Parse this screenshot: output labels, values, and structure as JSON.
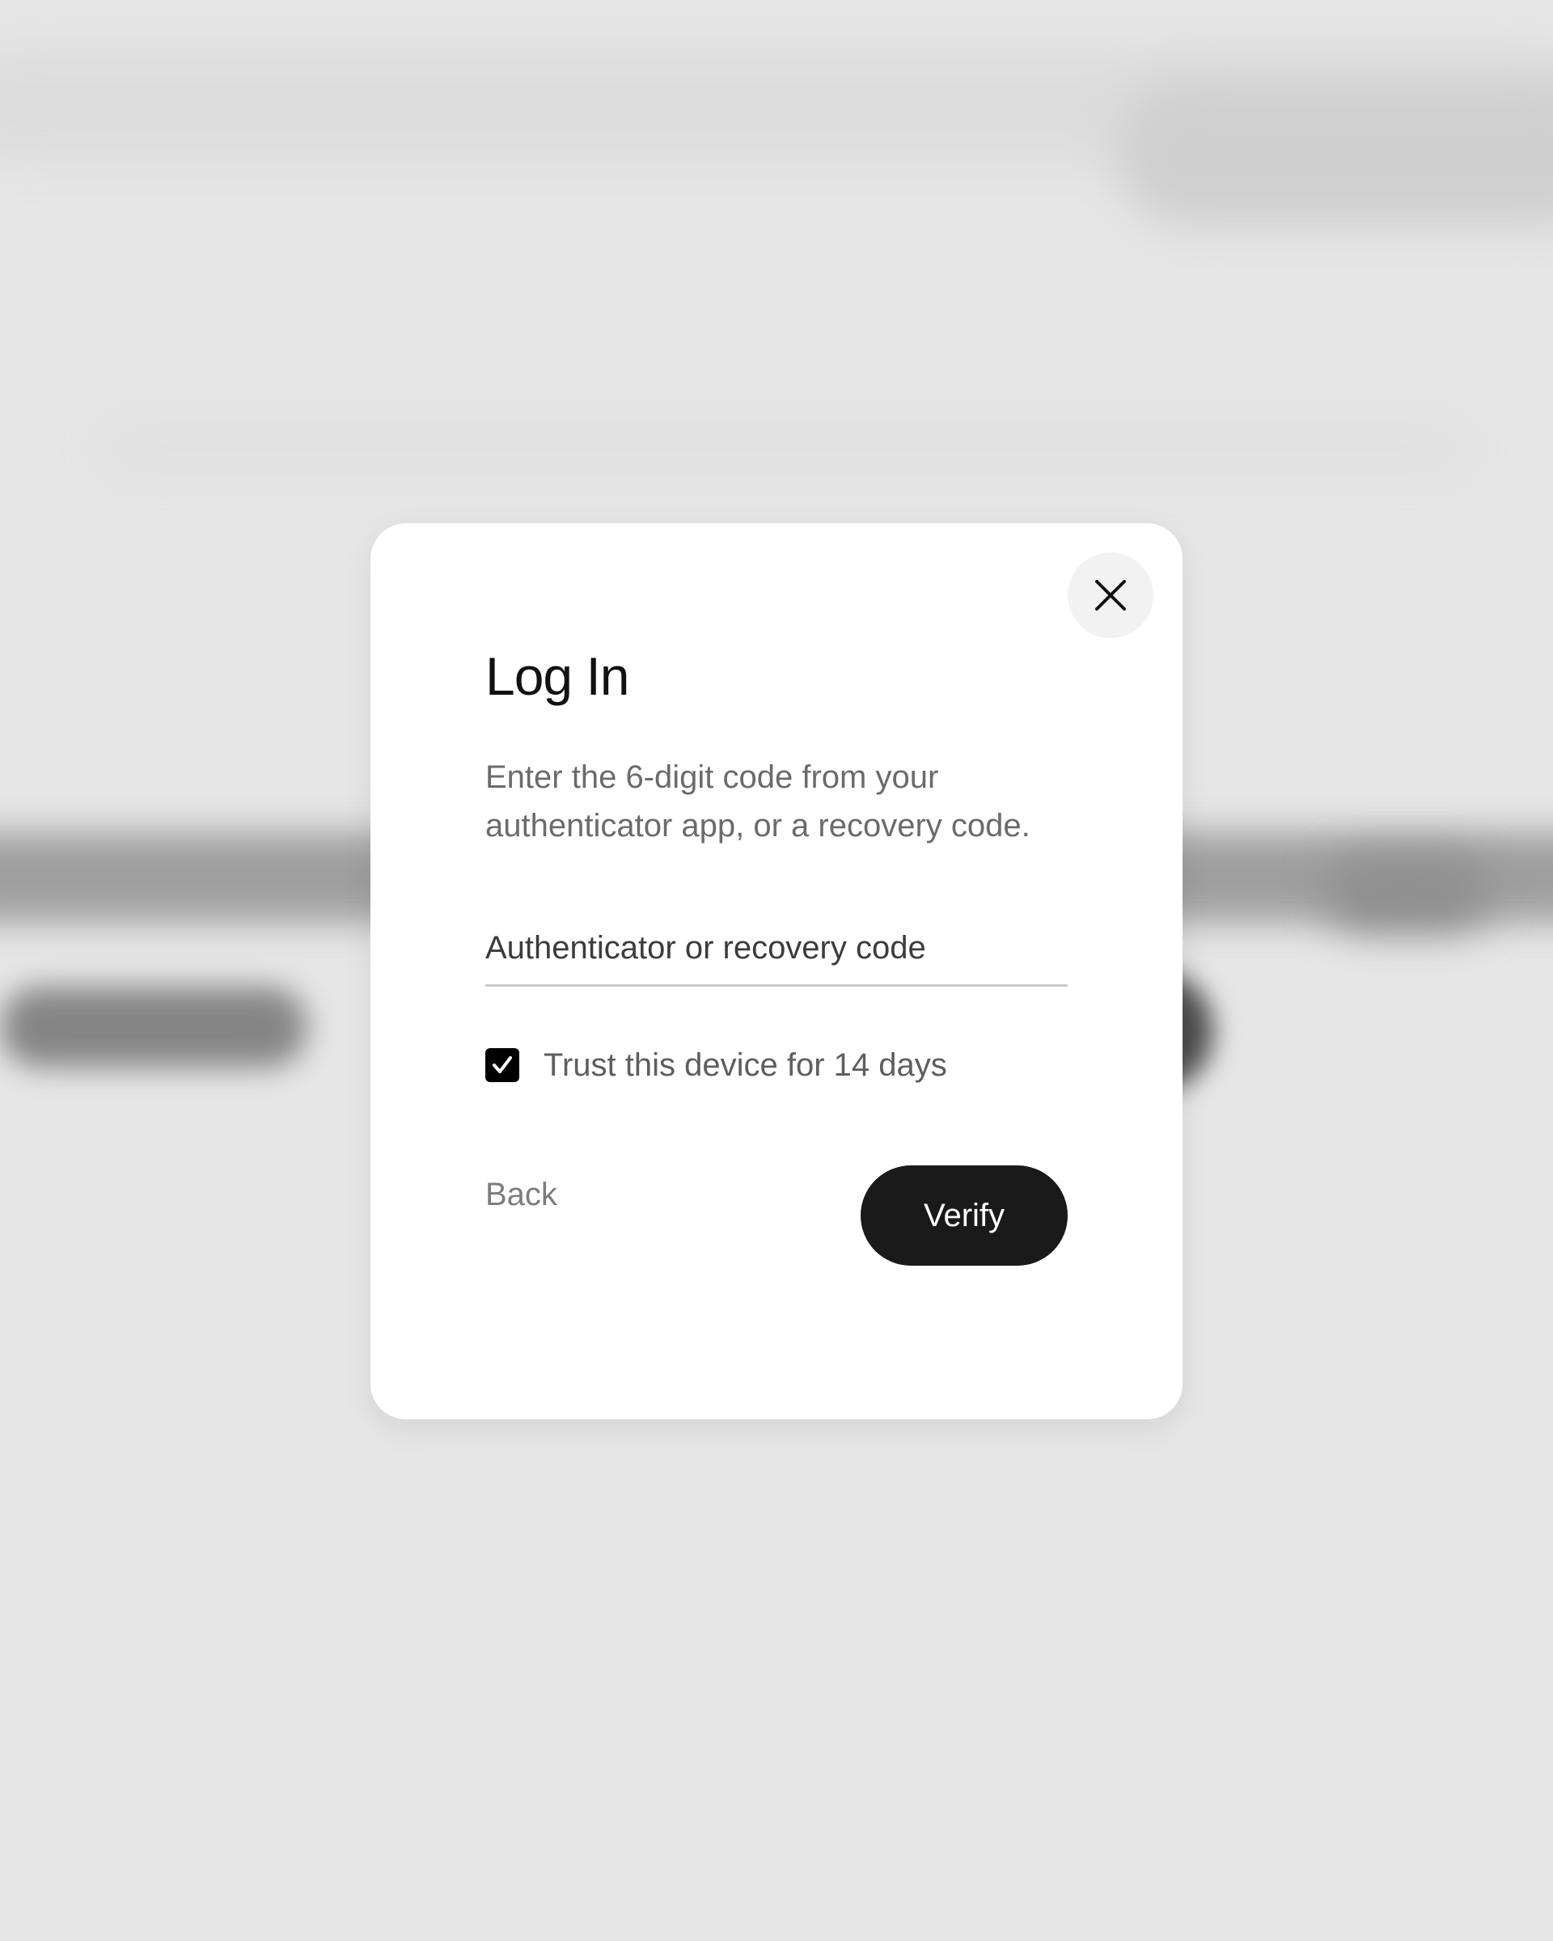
{
  "modal": {
    "title": "Log In",
    "description": "Enter the 6-digit code from your authenticator app, or a recovery code.",
    "close_icon": "close-icon",
    "code_input": {
      "placeholder": "Authenticator or recovery code",
      "value": ""
    },
    "trust_device": {
      "checked": true,
      "label": "Trust this device for 14 days"
    },
    "back_label": "Back",
    "verify_label": "Verify"
  },
  "colors": {
    "primary_button": "#1a1a1a",
    "overlay_background": "#e8e8e8",
    "modal_background": "#ffffff"
  }
}
